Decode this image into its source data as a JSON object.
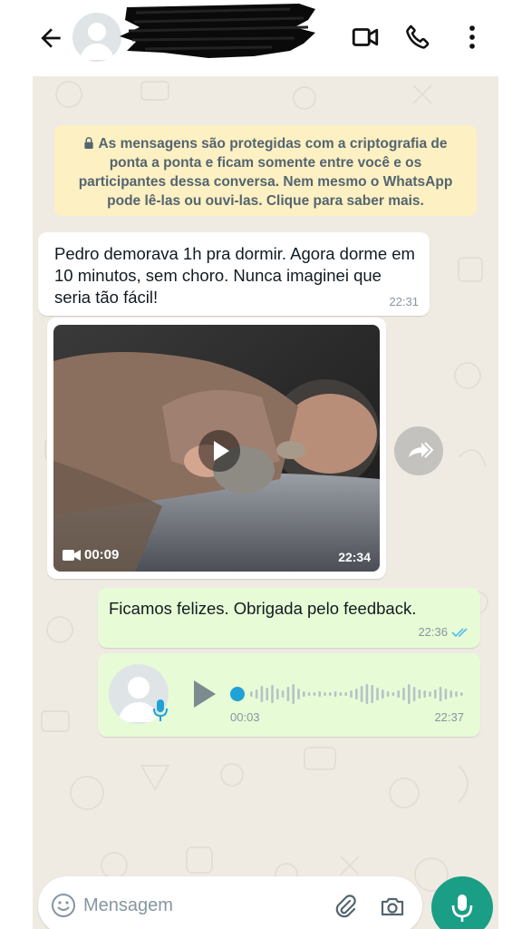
{
  "header": {
    "contact_name": "",
    "icons": [
      "back-arrow-icon",
      "video-call-icon",
      "phone-icon",
      "more-vertical-icon"
    ]
  },
  "encryption_notice": {
    "text": "As mensagens são protegidas com a criptografia de ponta a ponta e ficam somente entre você e os participantes dessa conversa. Nem mesmo o WhatsApp pode lê-las ou ouvi-las. Clique para saber mais."
  },
  "messages": [
    {
      "direction": "in",
      "text": "Pedro demorava 1h pra dormir. Agora dorme em 10 minutos, sem choro. Nunca imaginei que seria tão fácil!",
      "time": "22:31"
    },
    {
      "direction": "in",
      "type": "video",
      "duration": "00:09",
      "time": "22:34"
    },
    {
      "direction": "out",
      "text": "Ficamos felizes. Obrigada pelo feedback.",
      "time": "22:36",
      "status": "read"
    },
    {
      "direction": "out",
      "type": "voice",
      "elapsed": "00:03",
      "time": "22:37",
      "progress": 0.0
    }
  ],
  "composer": {
    "placeholder": "Mensagem"
  },
  "colors": {
    "chat_bg": "#efeae2",
    "incoming": "#ffffff",
    "outgoing": "#e7fcd6",
    "notice_bg": "#fdf0c3",
    "accent": "#1a9e86",
    "read_ticks": "#53bdeb"
  }
}
